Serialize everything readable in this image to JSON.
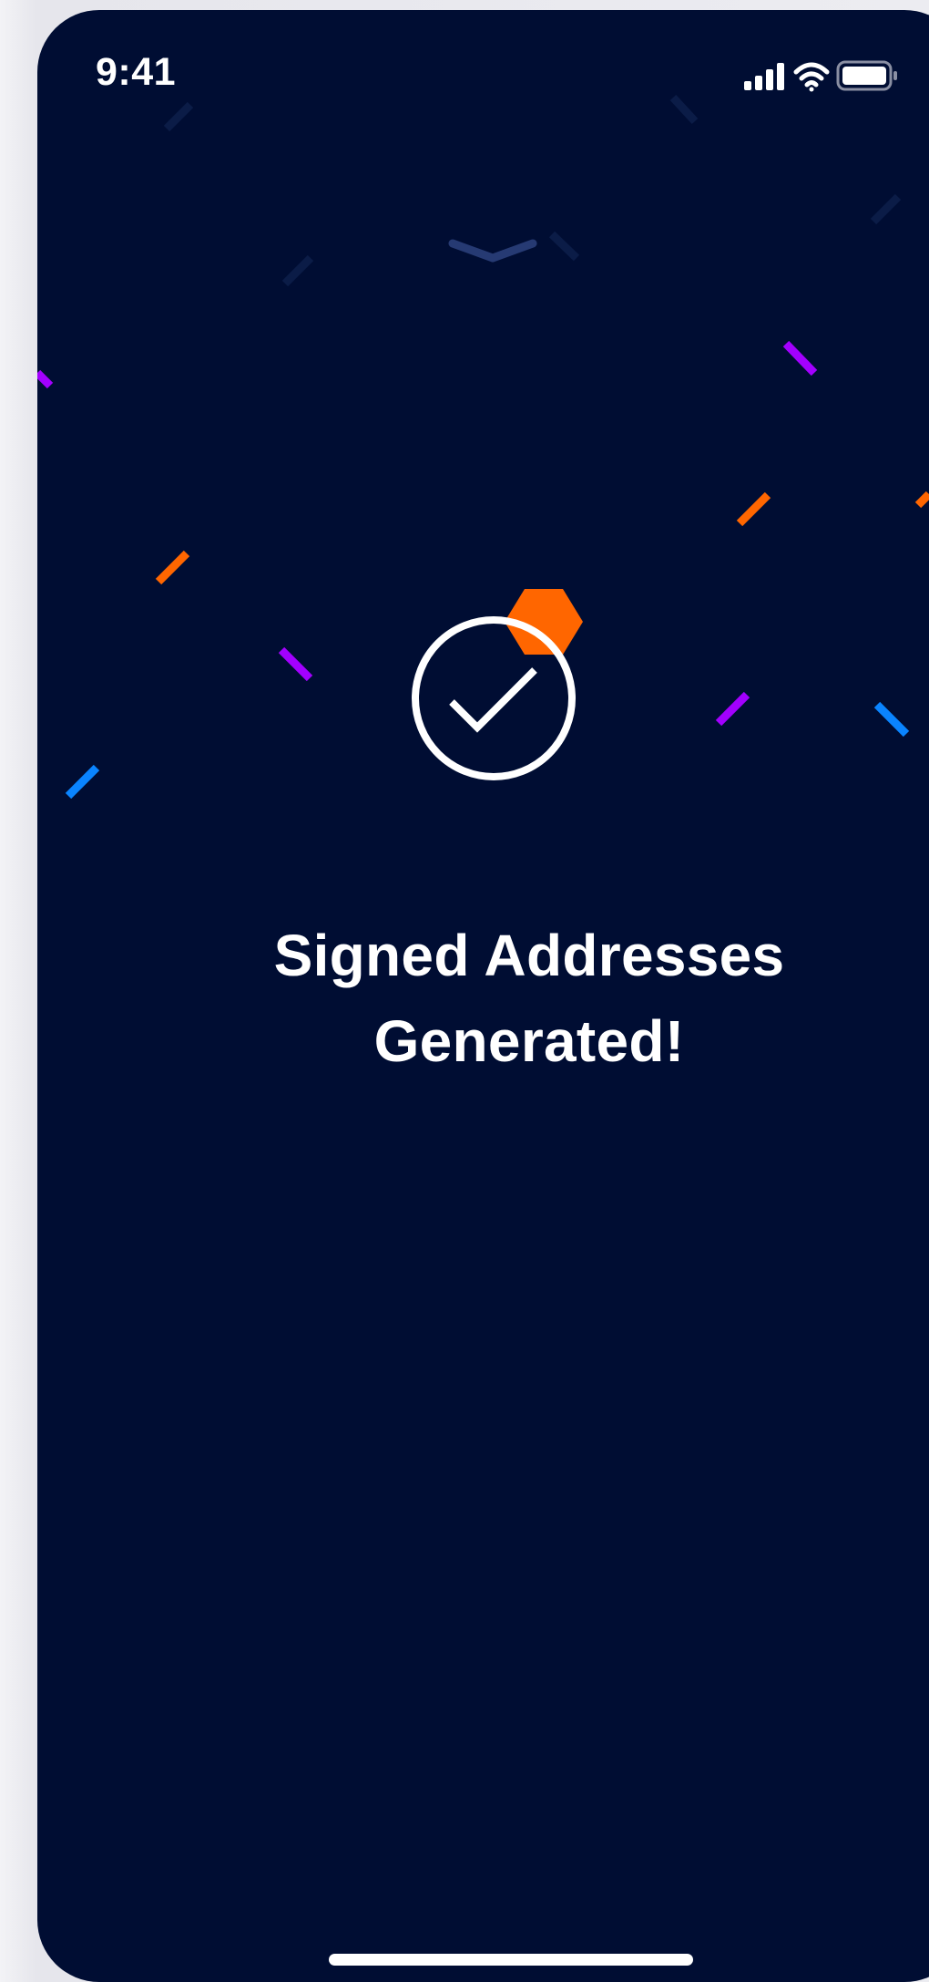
{
  "status_bar": {
    "time": "9:41",
    "signal_icon": "cellular-signal-icon",
    "wifi_icon": "wifi-icon",
    "battery_icon": "battery-icon"
  },
  "sheet": {
    "dismiss_icon": "chevron-down-icon"
  },
  "success": {
    "icon": "checkmark-circle-icon",
    "badge_icon": "hexagon-icon",
    "title_line1": "Signed Addresses",
    "title_line2": "Generated!"
  },
  "decoration": {
    "confetti_icon": "confetti-icon"
  },
  "colors": {
    "background": "#000d33",
    "text": "#ffffff",
    "accent_orange": "#ff6600",
    "accent_purple": "#a300ff",
    "accent_blue": "#0a84ff",
    "chevron": "#263a73"
  }
}
